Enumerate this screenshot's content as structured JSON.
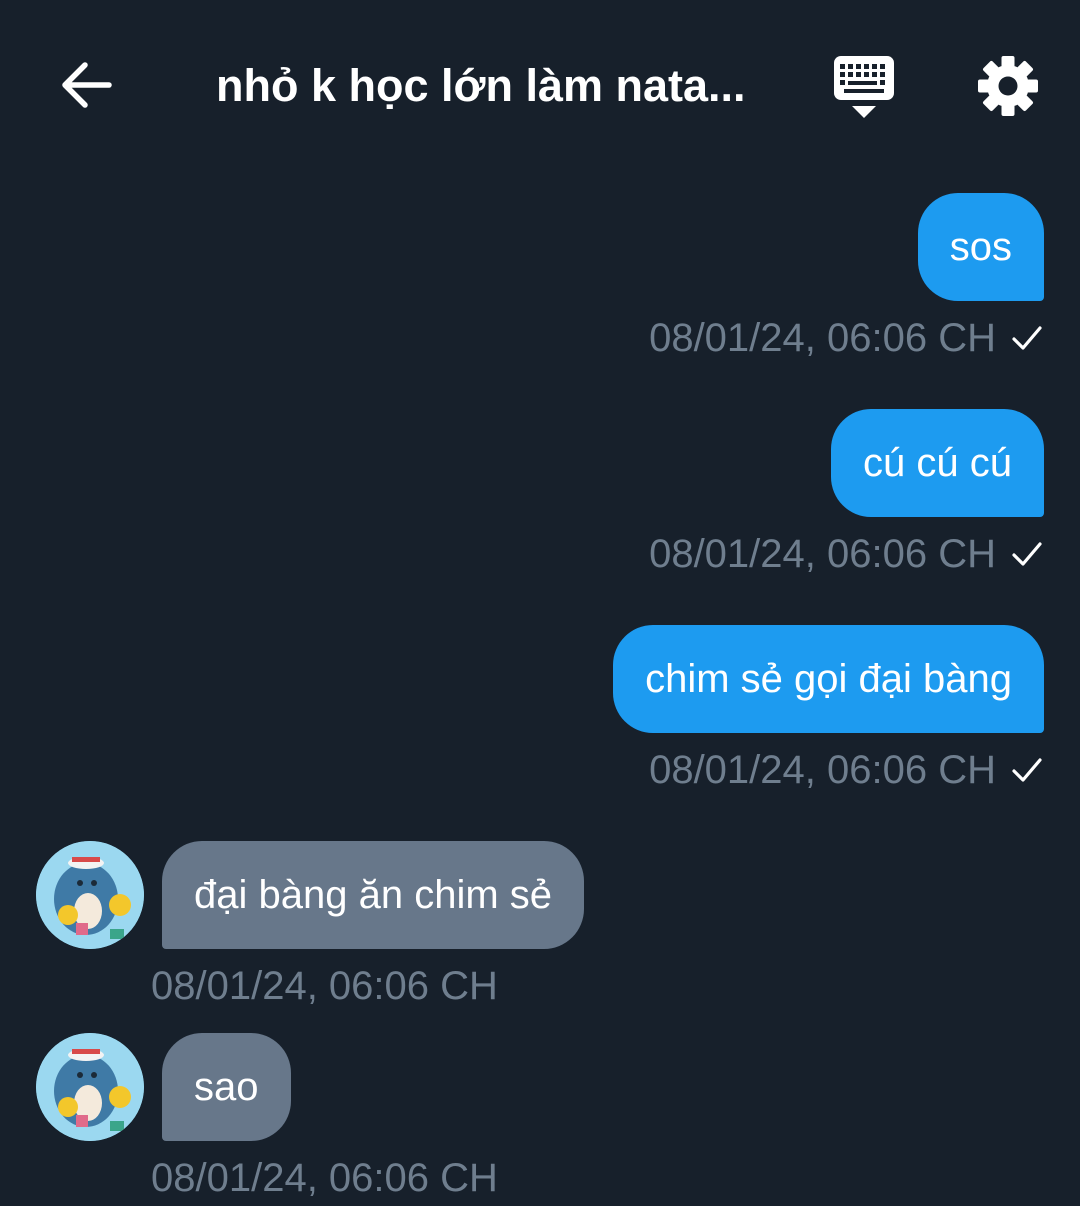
{
  "header": {
    "title": "nhỏ k học lớn làm nata...",
    "back_icon": "arrow-left-icon",
    "keyboard_icon": "keyboard-icon",
    "settings_icon": "gear-icon"
  },
  "messages": [
    {
      "direction": "outgoing",
      "text": "sos",
      "timestamp": "08/01/24, 06:06 CH",
      "status_icon": "checkmark-icon"
    },
    {
      "direction": "outgoing",
      "text": "cú cú cú",
      "timestamp": "08/01/24, 06:06 CH",
      "status_icon": "checkmark-icon"
    },
    {
      "direction": "outgoing",
      "text": "chim sẻ gọi đại bàng",
      "timestamp": "08/01/24, 06:06 CH",
      "status_icon": "checkmark-icon"
    },
    {
      "direction": "incoming",
      "text": "đại bàng ăn chim sẻ",
      "timestamp": "08/01/24, 06:06 CH",
      "avatar_icon": "penguin-avatar"
    },
    {
      "direction": "incoming",
      "text": "sao",
      "timestamp": "08/01/24, 06:06 CH",
      "avatar_icon": "penguin-avatar"
    }
  ],
  "colors": {
    "background": "#17202b",
    "outgoing_bubble": "#1d9bf0",
    "incoming_bubble": "#67778a",
    "timestamp": "#6f7e8e",
    "text": "#ffffff"
  }
}
